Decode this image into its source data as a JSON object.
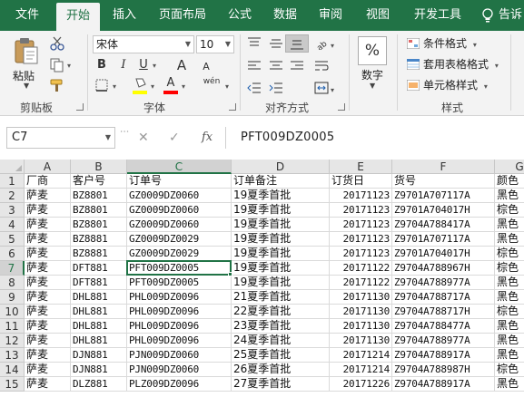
{
  "tabs": [
    {
      "label": "文件",
      "active": false
    },
    {
      "label": "开始",
      "active": true
    },
    {
      "label": "插入",
      "active": false
    },
    {
      "label": "页面布局",
      "active": false
    },
    {
      "label": "公式",
      "active": false
    },
    {
      "label": "数据",
      "active": false
    },
    {
      "label": "审阅",
      "active": false
    },
    {
      "label": "视图",
      "active": false
    },
    {
      "label": "开发工具",
      "active": false
    }
  ],
  "tell_me": "告诉",
  "ribbon": {
    "clipboard": {
      "paste_label": "粘贴",
      "group_label": "剪贴板"
    },
    "font": {
      "font_name": "宋体",
      "font_size": "10",
      "group_label": "字体",
      "bold": "B",
      "italic": "I",
      "underline": "U",
      "grow": "A",
      "shrink": "A",
      "phonetic": "wén",
      "font_color_glyph": "A",
      "fill_color": "#ffff00",
      "font_color": "#ff0000"
    },
    "alignment": {
      "group_label": "对齐方式"
    },
    "number": {
      "percent": "%",
      "label": "数字"
    },
    "styles": {
      "conditional": "条件格式",
      "table_format": "套用表格格式",
      "cell_styles": "单元格样式",
      "group_label": "样式"
    }
  },
  "formula_bar": {
    "name_box": "C7",
    "cancel_glyph": "✕",
    "enter_glyph": "✓",
    "fx_glyph": "fx",
    "formula": "PFT009DZ0005"
  },
  "grid": {
    "columns": [
      "A",
      "B",
      "C",
      "D",
      "E",
      "F",
      "G"
    ],
    "selected_column": "C",
    "selected_row": 7,
    "rows": [
      {
        "n": "1",
        "cells": [
          "厂商",
          "客户号",
          "订单号",
          "订单备注",
          "订货日",
          "货号",
          "颜色"
        ]
      },
      {
        "n": "2",
        "cells": [
          "萨麦",
          "BZ8801",
          "GZ0009DZ0060",
          "19夏季首批",
          "20171123",
          "Z9701A707117A",
          "黑色"
        ]
      },
      {
        "n": "3",
        "cells": [
          "萨麦",
          "BZ8801",
          "GZ0009DZ0060",
          "19夏季首批",
          "20171123",
          "Z9701A704017H",
          "棕色"
        ]
      },
      {
        "n": "4",
        "cells": [
          "萨麦",
          "BZ8801",
          "GZ0009DZ0060",
          "19夏季首批",
          "20171123",
          "Z9704A788417A",
          "黑色"
        ]
      },
      {
        "n": "5",
        "cells": [
          "萨麦",
          "BZ8881",
          "GZ0009DZ0029",
          "19夏季首批",
          "20171123",
          "Z9701A707117A",
          "黑色"
        ]
      },
      {
        "n": "6",
        "cells": [
          "萨麦",
          "BZ8881",
          "GZ0009DZ0029",
          "19夏季首批",
          "20171123",
          "Z9701A704017H",
          "棕色"
        ]
      },
      {
        "n": "7",
        "cells": [
          "萨麦",
          "DFT881",
          "PFT009DZ0005",
          "19夏季首批",
          "20171122",
          "Z9704A788967H",
          "棕色"
        ]
      },
      {
        "n": "8",
        "cells": [
          "萨麦",
          "DFT881",
          "PFT009DZ0005",
          "19夏季首批",
          "20171122",
          "Z9704A788977A",
          "黑色"
        ]
      },
      {
        "n": "9",
        "cells": [
          "萨麦",
          "DHL881",
          "PHL009DZ0096",
          "21夏季首批",
          "20171130",
          "Z9704A788717A",
          "黑色"
        ]
      },
      {
        "n": "10",
        "cells": [
          "萨麦",
          "DHL881",
          "PHL009DZ0096",
          "22夏季首批",
          "20171130",
          "Z9704A788717H",
          "棕色"
        ]
      },
      {
        "n": "11",
        "cells": [
          "萨麦",
          "DHL881",
          "PHL009DZ0096",
          "23夏季首批",
          "20171130",
          "Z9704A788477A",
          "黑色"
        ]
      },
      {
        "n": "12",
        "cells": [
          "萨麦",
          "DHL881",
          "PHL009DZ0096",
          "24夏季首批",
          "20171130",
          "Z9704A788977A",
          "黑色"
        ]
      },
      {
        "n": "13",
        "cells": [
          "萨麦",
          "DJN881",
          "PJN009DZ0060",
          "25夏季首批",
          "20171214",
          "Z9704A788917A",
          "黑色"
        ]
      },
      {
        "n": "14",
        "cells": [
          "萨麦",
          "DJN881",
          "PJN009DZ0060",
          "26夏季首批",
          "20171214",
          "Z9704A788987H",
          "棕色"
        ]
      },
      {
        "n": "15",
        "cells": [
          "萨麦",
          "DLZ881",
          "PLZ009DZ0096",
          "27夏季首批",
          "20171226",
          "Z9704A788917A",
          "黑色"
        ]
      }
    ]
  }
}
